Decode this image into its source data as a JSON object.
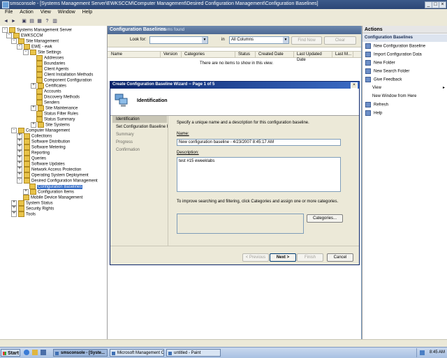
{
  "window": {
    "title": "smsconsole - [Systems Management Server\\EWKSCCM\\Computer Management\\Desired Configuration Management\\Configuration Baselines]"
  },
  "menu": [
    "File",
    "Action",
    "View",
    "Window",
    "Help"
  ],
  "toolbar_icons": [
    "back-icon",
    "forward-icon",
    "up-folder-icon",
    "show-tree-icon",
    "properties-icon",
    "help-icon",
    "console-icon"
  ],
  "tree": {
    "root": "Systems Management Server",
    "site": "EWKSCCM",
    "site_management": "Site Management",
    "site_node": "EWE - ewk",
    "site_settings": "Site Settings",
    "site_settings_items": [
      "Addresses",
      "Boundaries",
      "Client Agents",
      "Client Installation Methods",
      "Component Configuration",
      "Certificates",
      "Accounts",
      "Discovery Methods",
      "Senders",
      "Site Maintenance",
      "Status Filter Rules",
      "Status Summary",
      "Site Systems"
    ],
    "computer_management": "Computer Management",
    "cm_items": [
      "Collections",
      "Software Distribution",
      "Software Metering",
      "Reporting",
      "Queries",
      "Software Updates",
      "Network Access Protection",
      "Operating System Deployment",
      "Desired Configuration Management"
    ],
    "dcm_items": [
      "Configuration Baselines",
      "Configuration Items"
    ],
    "mobile": "Mobile Device Management",
    "system_status": "System Status",
    "security_rights": "Security Rights",
    "tools": "Tools"
  },
  "center": {
    "header": "Configuration Baselines",
    "count": "0 items found",
    "look_for_label": "Look for:",
    "look_for_value": "",
    "in_label": "in",
    "in_value": "All Columns",
    "find_now": "Find Now",
    "clear": "Clear",
    "columns": [
      "Name",
      "Version",
      "Categories",
      "Status",
      "Created Date",
      "Last Updated Date",
      "Last M..."
    ],
    "empty_message": "There are no items to show in this view."
  },
  "dialog": {
    "title": "Create Configuration Baseline Wizard -- Page 1 of 5",
    "heading": "Identification",
    "steps": [
      "Identification",
      "Set Configuration Baseline Rules",
      "Summary",
      "Progress",
      "Confirmation"
    ],
    "instruction": "Specify a unique name and a description for this configuration baseline.",
    "name_label": "Name:",
    "name_value": "New configuration baseline - 4/23/2007 8:45:17 AM",
    "description_label": "Description:",
    "description_value": "test #15 eweeklabs",
    "categories_hint": "To improve searching and filtering, click Categories and assign one or more categories.",
    "categories_button": "Categories...",
    "previous_button": "< Previous",
    "next_button": "Next >",
    "finish_button": "Finish",
    "cancel_button": "Cancel"
  },
  "actions": {
    "header": "Actions",
    "section": "Configuration Baselines",
    "items": [
      "New Configuration Baseline",
      "Import Configuration Data",
      "New Folder",
      "New Search Folder",
      "Give Feedback",
      "View",
      "New Window from Here",
      "Refresh",
      "Help"
    ]
  },
  "taskbar": {
    "start": "Start",
    "tasks": [
      "smsconsole - [Syste...",
      "Microsoft Management C...",
      "untitled - Paint"
    ],
    "clock": "8:45 AM"
  }
}
